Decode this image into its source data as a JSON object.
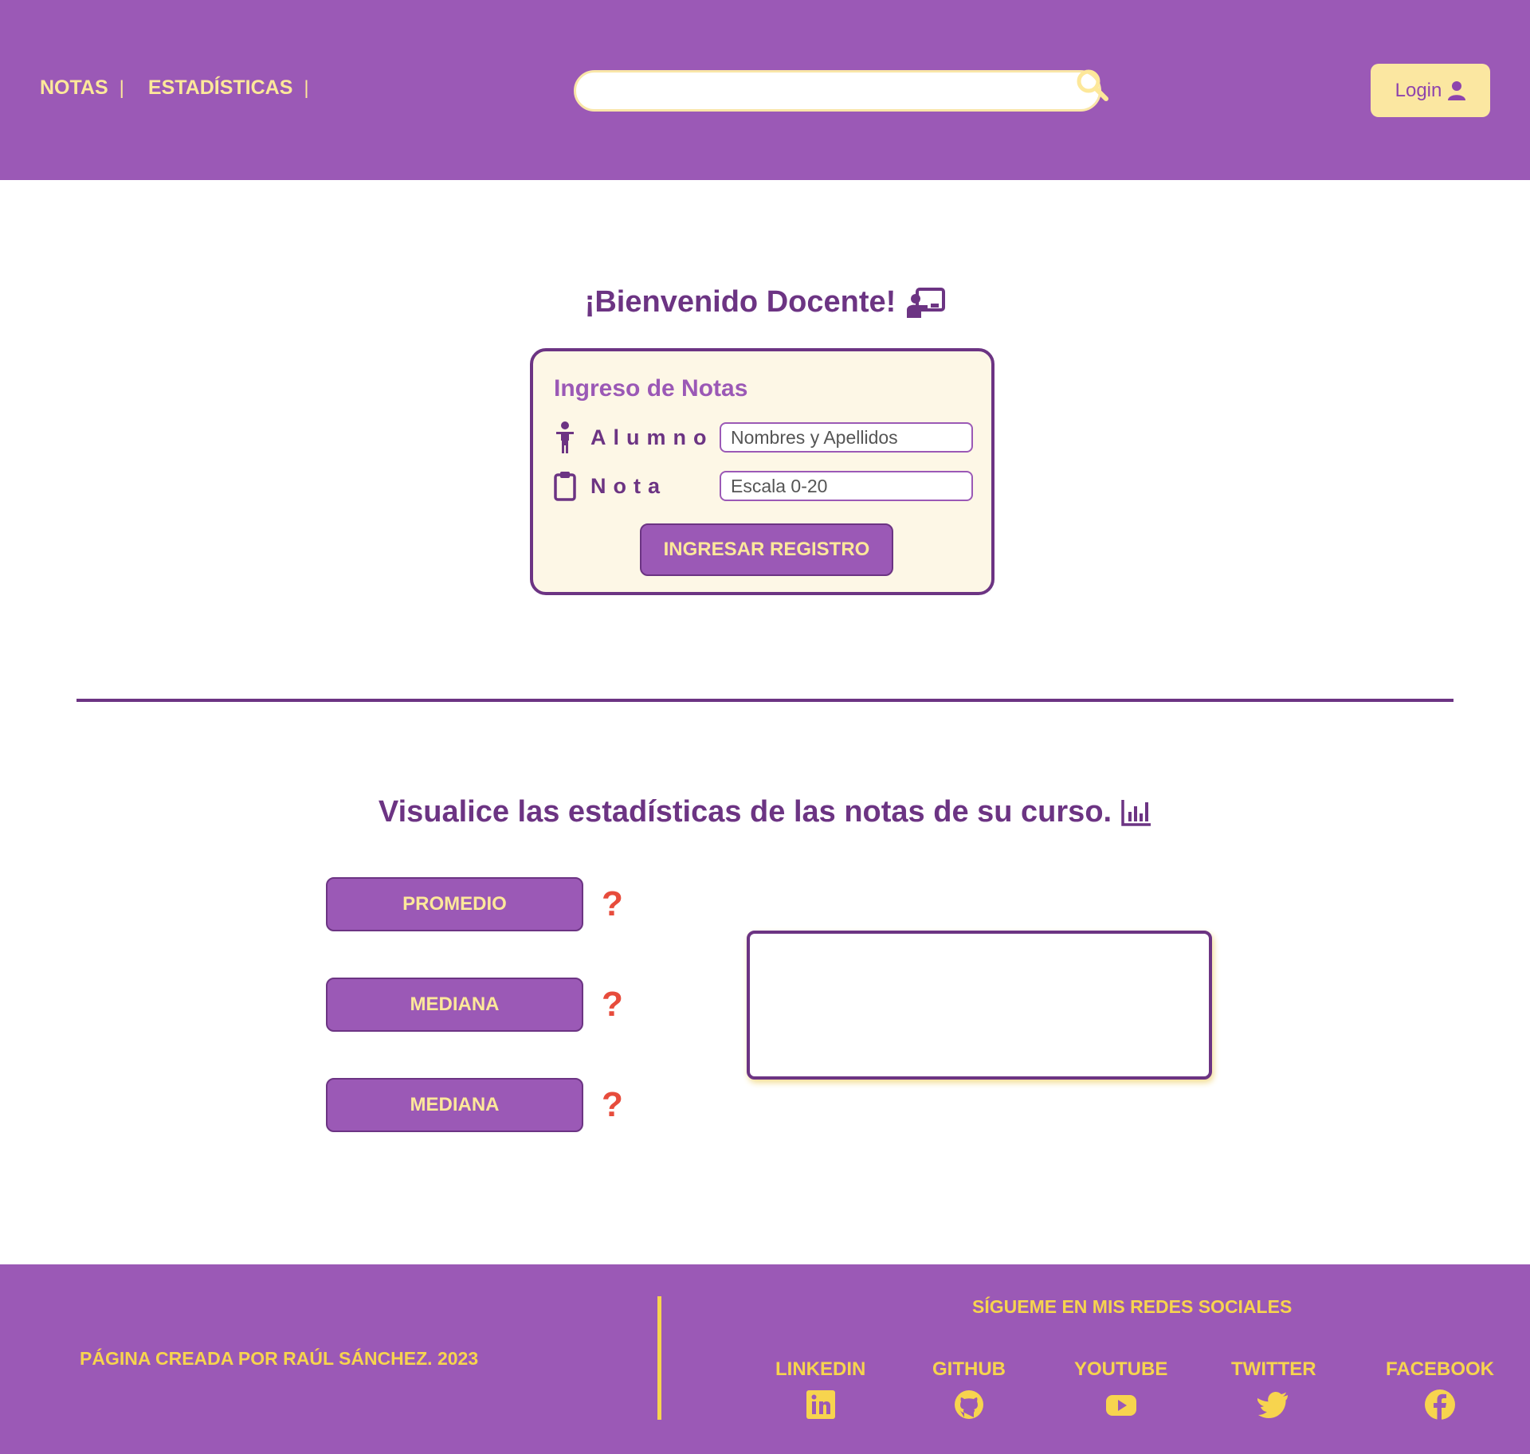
{
  "header": {
    "nav": [
      {
        "label": "NOTAS",
        "separator": "|"
      },
      {
        "label": "ESTADÍSTICAS",
        "separator": "|"
      }
    ],
    "search_value": "",
    "login_label": "Login"
  },
  "welcome": {
    "title": "¡Bienvenido Docente!"
  },
  "form": {
    "title": "Ingreso de Notas",
    "student_label": "Alumno",
    "student_placeholder": "Nombres y Apellidos",
    "grade_label": "Nota",
    "grade_placeholder": "Escala 0-20",
    "submit_label": "INGRESAR REGISTRO"
  },
  "stats": {
    "title": "Visualice las estadísticas de las notas de su curso.",
    "buttons": [
      {
        "label": "PROMEDIO",
        "help": "?"
      },
      {
        "label": "MEDIANA",
        "help": "?"
      },
      {
        "label": "MEDIANA",
        "help": "?"
      }
    ],
    "result": ""
  },
  "footer": {
    "credit": "PÁGINA CREADA POR RAÚL SÁNCHEZ. 2023",
    "follow": "SÍGUEME EN MIS REDES SOCIALES",
    "social": [
      {
        "label": "LINKEDIN",
        "icon": "linkedin-icon"
      },
      {
        "label": "GITHUB",
        "icon": "github-icon"
      },
      {
        "label": "YOUTUBE",
        "icon": "youtube-icon"
      },
      {
        "label": "TWITTER",
        "icon": "twitter-icon"
      },
      {
        "label": "FACEBOOK",
        "icon": "facebook-icon"
      }
    ]
  },
  "colors": {
    "primary": "#9b59b6",
    "dark": "#6c3483",
    "accent": "#fde89a",
    "gold": "#f7d44e",
    "help": "#e74c3c"
  }
}
